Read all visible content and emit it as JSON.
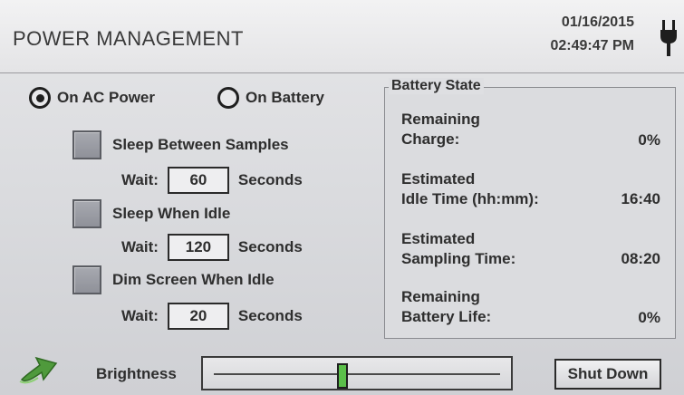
{
  "header": {
    "title": "POWER MANAGEMENT",
    "date": "01/16/2015",
    "time": "02:49:47 PM",
    "power_icon": "plug-icon"
  },
  "power_source": {
    "ac_label": "On AC Power",
    "battery_label": "On Battery",
    "selected": "ac"
  },
  "options": [
    {
      "label": "Sleep Between Samples",
      "wait_label": "Wait:",
      "wait_value": "60",
      "unit": "Seconds",
      "checked": false
    },
    {
      "label": "Sleep When Idle",
      "wait_label": "Wait:",
      "wait_value": "120",
      "unit": "Seconds",
      "checked": false
    },
    {
      "label": "Dim Screen When Idle",
      "wait_label": "Wait:",
      "wait_value": "20",
      "unit": "Seconds",
      "checked": false
    }
  ],
  "battery_state": {
    "title": "Battery State",
    "rows": [
      {
        "line1": "Remaining",
        "line2": "Charge:",
        "value": "0%"
      },
      {
        "line1": "Estimated",
        "line2": "Idle Time (hh:mm):",
        "value": "16:40"
      },
      {
        "line1": "Estimated",
        "line2": "Sampling Time:",
        "value": "08:20"
      },
      {
        "line1": "Remaining",
        "line2": "Battery Life:",
        "value": "0%"
      }
    ]
  },
  "footer": {
    "back_icon": "back-arrow-icon",
    "brightness_label": "Brightness",
    "brightness_level": 0.45,
    "shutdown_label": "Shut Down"
  },
  "colors": {
    "thumb": "#5bbf4a",
    "arrow": "#4f9a3c"
  }
}
